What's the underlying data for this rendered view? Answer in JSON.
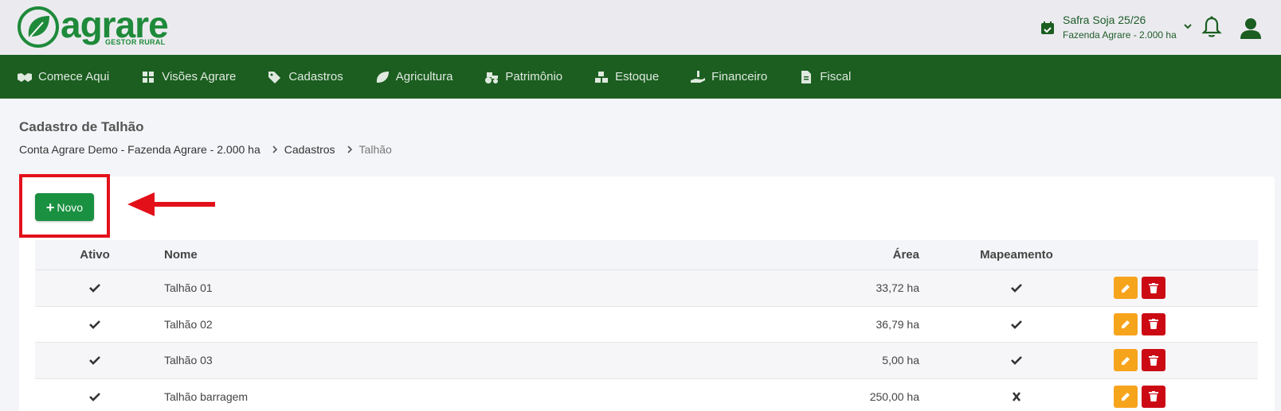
{
  "brand": {
    "name": "agrare",
    "tagline": "GESTOR RURAL",
    "color": "#1e8a3a"
  },
  "safra": {
    "title": "Safra Soja 25/26",
    "farm": "Fazenda Agrare - 2.000 ha"
  },
  "nav": {
    "items": [
      {
        "label": "Comece Aqui",
        "icon": "handshake-icon"
      },
      {
        "label": "Visões Agrare",
        "icon": "grid-icon"
      },
      {
        "label": "Cadastros",
        "icon": "tags-icon"
      },
      {
        "label": "Agricultura",
        "icon": "leaf-icon"
      },
      {
        "label": "Patrimônio",
        "icon": "tractor-icon"
      },
      {
        "label": "Estoque",
        "icon": "boxes-icon"
      },
      {
        "label": "Financeiro",
        "icon": "hand-dollar-icon"
      },
      {
        "label": "Fiscal",
        "icon": "invoice-icon"
      }
    ]
  },
  "page": {
    "title": "Cadastro de Talhão",
    "breadcrumb": [
      "Conta Agrare Demo - Fazenda Agrare - 2.000 ha",
      "Cadastros",
      "Talhão"
    ]
  },
  "actions": {
    "new_label": "Novo"
  },
  "table": {
    "headers": {
      "ativo": "Ativo",
      "nome": "Nome",
      "area": "Área",
      "mapeamento": "Mapeamento"
    },
    "rows": [
      {
        "ativo": true,
        "nome": "Talhão 01",
        "area": "33,72 ha",
        "mapeamento": true
      },
      {
        "ativo": true,
        "nome": "Talhão 02",
        "area": "36,79 ha",
        "mapeamento": true
      },
      {
        "ativo": true,
        "nome": "Talhão 03",
        "area": "5,00 ha",
        "mapeamento": true
      },
      {
        "ativo": true,
        "nome": "Talhão barragem",
        "area": "250,00 ha",
        "mapeamento": false
      }
    ]
  },
  "colors": {
    "nav_bg": "#1b5e20",
    "primary": "#1a9141",
    "edit": "#f7a41d",
    "delete": "#cc0a14",
    "highlight": "#e3101a"
  }
}
